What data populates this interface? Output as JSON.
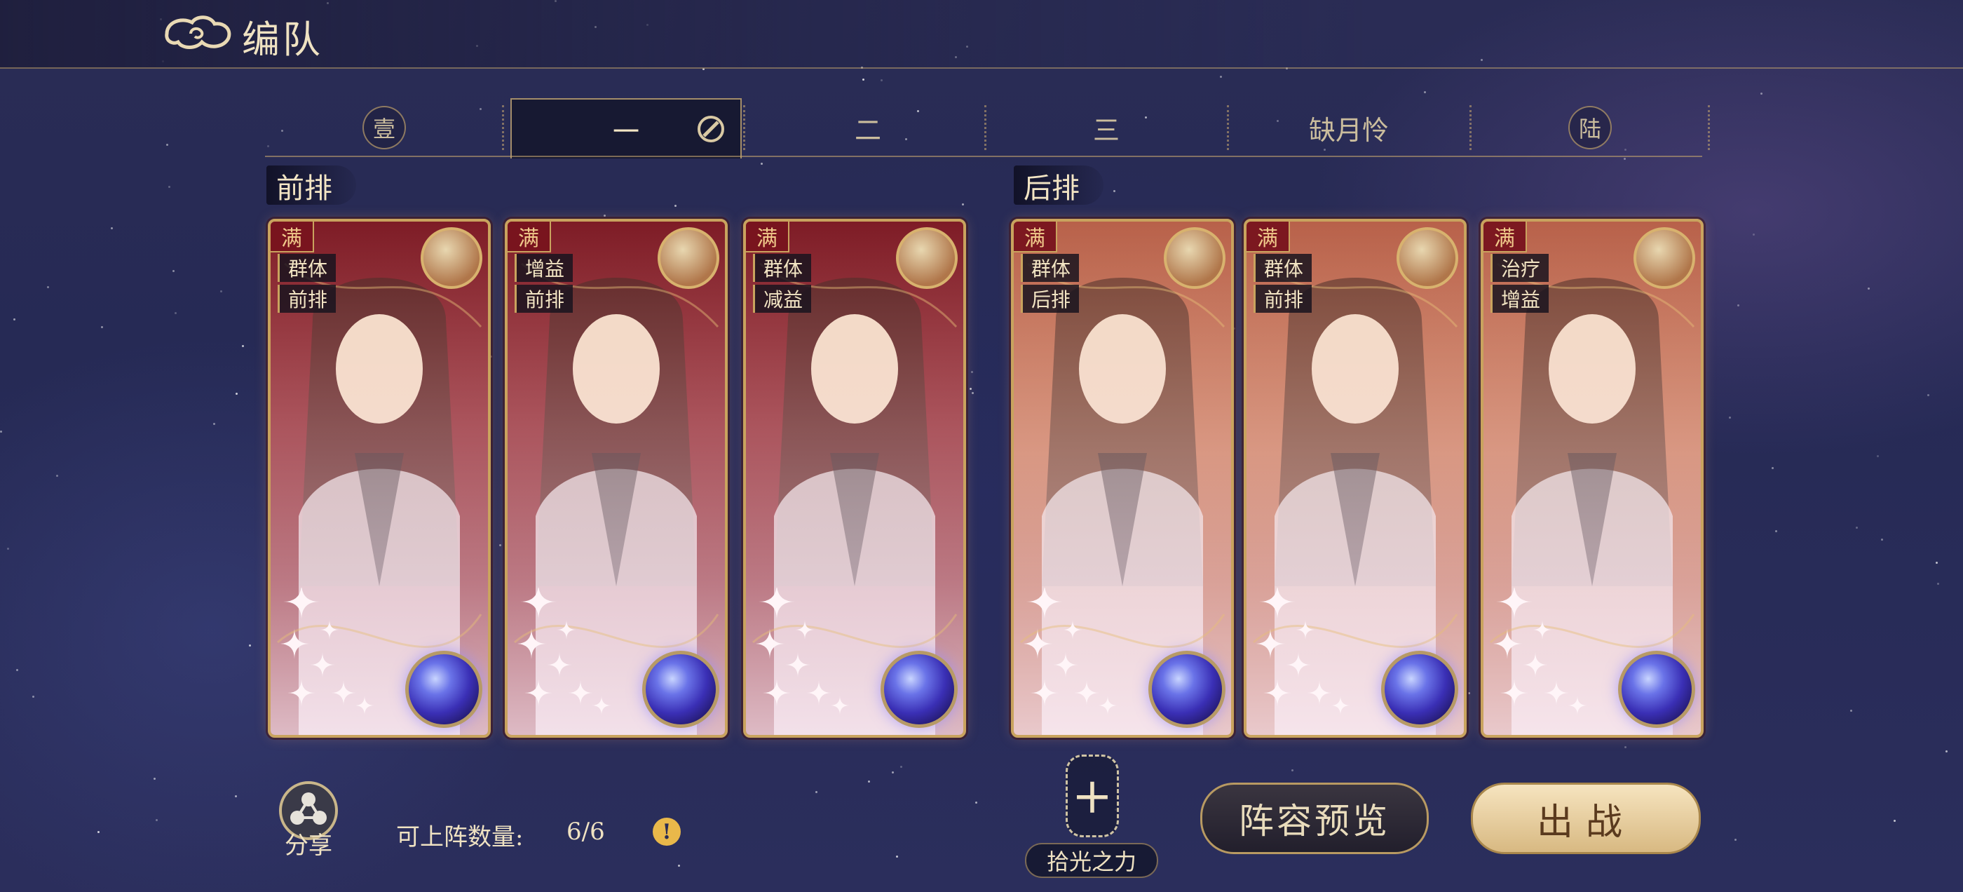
{
  "header": {
    "title": "编队",
    "back_icon": "cloud-back-icon"
  },
  "tabs": [
    {
      "label": "壹",
      "style": "circle",
      "active": false
    },
    {
      "label": "一",
      "style": "plain",
      "active": true,
      "has_edit_icon": true
    },
    {
      "label": "二",
      "style": "plain",
      "active": false
    },
    {
      "label": "三",
      "style": "plain",
      "active": false
    },
    {
      "label": "缺月怜",
      "style": "plain",
      "active": false
    },
    {
      "label": "陆",
      "style": "circle",
      "active": false
    }
  ],
  "sections": {
    "front": "前排",
    "back": "后排"
  },
  "cards": [
    {
      "row": "front",
      "badge": "满",
      "tags": [
        "群体",
        "前排"
      ],
      "pet": "blue-wolf-pet",
      "theme": "#7e1c26"
    },
    {
      "row": "front",
      "badge": "满",
      "tags": [
        "增益",
        "前排"
      ],
      "pet": "white-fox-pet",
      "theme": "#8e2430"
    },
    {
      "row": "front",
      "badge": "满",
      "tags": [
        "群体",
        "减益"
      ],
      "pet": "white-cat-pet",
      "theme": "#7a1a25"
    },
    {
      "row": "back",
      "badge": "满",
      "tags": [
        "群体",
        "后排"
      ],
      "pet": "white-ghost-pet",
      "theme": "#b8614a"
    },
    {
      "row": "back",
      "badge": "满",
      "tags": [
        "群体",
        "前排"
      ],
      "pet": "white-crane-pet",
      "theme": "#c9795c"
    },
    {
      "row": "back",
      "badge": "满",
      "tags": [
        "治疗",
        "增益"
      ],
      "pet": "white-goat-pet",
      "theme": "#a85440"
    }
  ],
  "bottom": {
    "share_label": "分享",
    "count_label": "可上阵数量:",
    "count_value": "6/6",
    "info_symbol": "!",
    "power_plus": "+",
    "power_label": "拾光之力",
    "preview_label": "阵容预览",
    "battle_label": "出战"
  }
}
